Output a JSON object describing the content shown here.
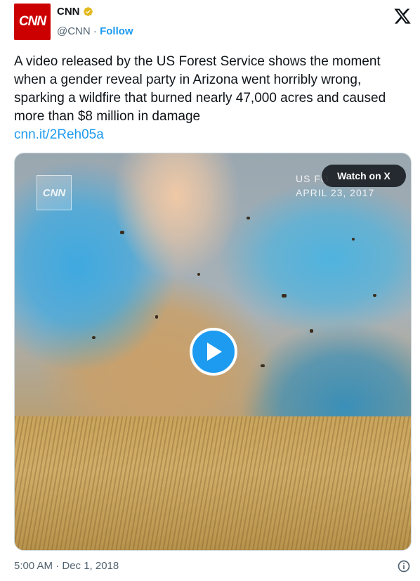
{
  "author": {
    "avatar_text": "CNN",
    "name": "CNN",
    "handle": "@CNN",
    "separator": " · ",
    "follow_label": "Follow",
    "verified_icon": "verified-badge-icon",
    "platform_icon": "x-logo-icon"
  },
  "tweet": {
    "text": "A video released by the US Forest Service shows the moment when a gender reveal party in Arizona went horribly wrong, sparking a wildfire that burned nearly 47,000 acres and caused more than $8 million in damage",
    "link": "cnn.it/2Reh05a"
  },
  "media": {
    "watermark": "CNN",
    "caption_line1": "US FO",
    "caption_line2": "APRIL 23, 2017",
    "watch_label": "Watch on X",
    "play_icon": "play-icon"
  },
  "footer": {
    "timestamp": "5:00 AM · Dec 1, 2018",
    "info_icon": "info-icon"
  },
  "colors": {
    "accent": "#1d9bf0",
    "brand_red": "#cc0000",
    "text": "#0f1419",
    "muted": "#536471",
    "verified_gold": "#e2b719"
  }
}
